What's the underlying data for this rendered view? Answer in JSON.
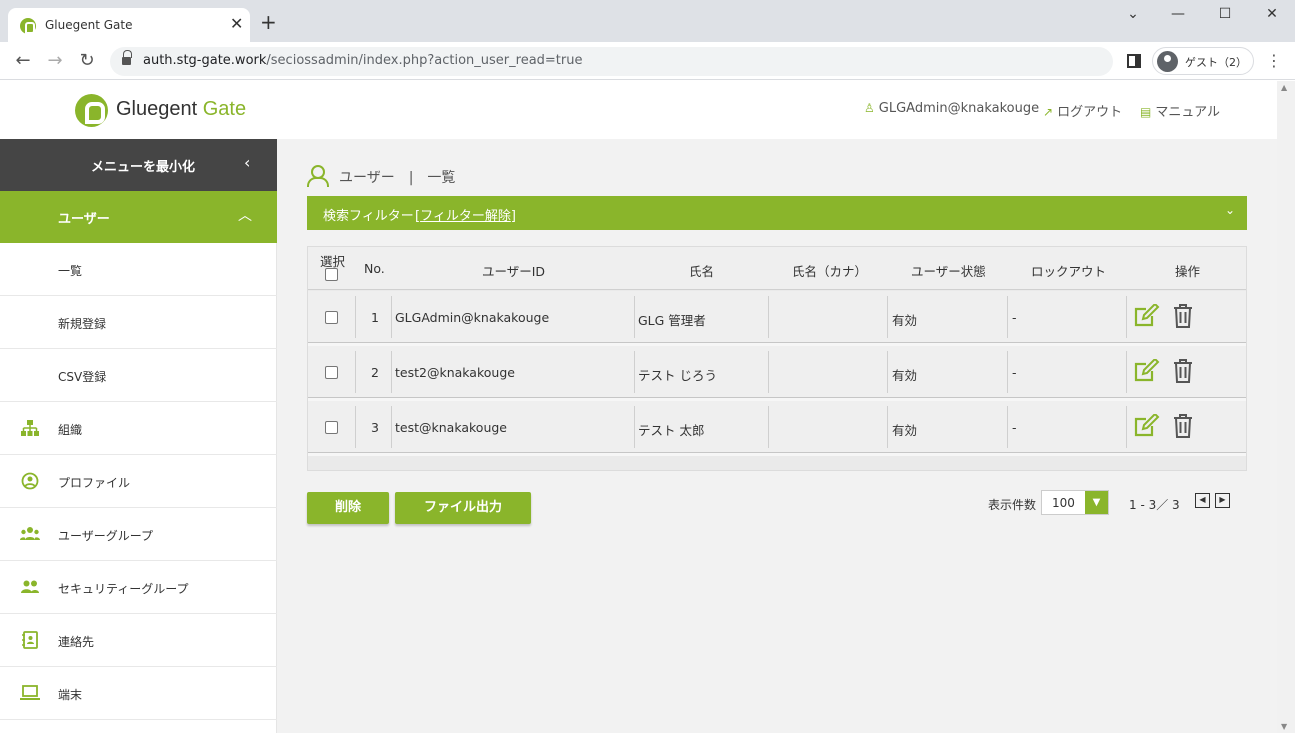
{
  "browser": {
    "tab_title": "Gluegent Gate",
    "tab_close": "✕",
    "new_tab": "+",
    "url_host": "auth.stg-gate.work",
    "url_path": "/seciossadmin/index.php?action_user_read=true",
    "profile_label": "ゲスト（2）",
    "win_minimize": "—",
    "win_maximize": "☐",
    "win_close": "✕",
    "win_menu": "⌄",
    "back": "←",
    "forward": "→",
    "reload": "↻",
    "menu": "⋮"
  },
  "header": {
    "logo_main": "Gluegent ",
    "logo_accent": "Gate",
    "user_label": "GLGAdmin@knakakouge",
    "logout_label": "ログアウト",
    "manual_label": "マニュアル"
  },
  "sidebar": {
    "collapse_label": "メニューを最小化",
    "collapse_chevron": "‹",
    "user_section": "ユーザー",
    "user_chevron": "︿",
    "sub_items": [
      {
        "label": "一覧"
      },
      {
        "label": "新規登録"
      },
      {
        "label": "CSV登録"
      }
    ],
    "items": [
      {
        "label": "組織",
        "icon": "org-icon"
      },
      {
        "label": "プロファイル",
        "icon": "profile-icon"
      },
      {
        "label": "ユーザーグループ",
        "icon": "users-group-icon"
      },
      {
        "label": "セキュリティーグループ",
        "icon": "security-group-icon"
      },
      {
        "label": "連絡先",
        "icon": "contact-icon"
      },
      {
        "label": "端末",
        "icon": "device-icon"
      }
    ]
  },
  "main": {
    "title": "ユーザー　|　一覧",
    "filter_label": "検索フィルター",
    "filter_link": "フィルター解除",
    "columns": {
      "select": "選択",
      "no": "No.",
      "user_id": "ユーザーID",
      "name": "氏名",
      "name_kana": "氏名（カナ）",
      "status": "ユーザー状態",
      "lockout": "ロックアウト",
      "actions": "操作"
    },
    "rows": [
      {
        "no": "1",
        "user_id": "GLGAdmin@knakakouge",
        "name": "GLG 管理者",
        "name_kana": "",
        "status": "有効",
        "lockout": "-"
      },
      {
        "no": "2",
        "user_id": "test2@knakakouge",
        "name": "テスト じろう",
        "name_kana": "",
        "status": "有効",
        "lockout": "-"
      },
      {
        "no": "3",
        "user_id": "test@knakakouge",
        "name": "テスト 太郎",
        "name_kana": "",
        "status": "有効",
        "lockout": "-"
      }
    ],
    "delete_button": "削除",
    "export_button": "ファイル出力",
    "pager": {
      "per_page_label": "表示件数",
      "per_page_value": "100",
      "range": "1 - 3／ 3"
    }
  },
  "colors": {
    "brand": "#8ab52b",
    "sidebar_dark": "#454545"
  }
}
